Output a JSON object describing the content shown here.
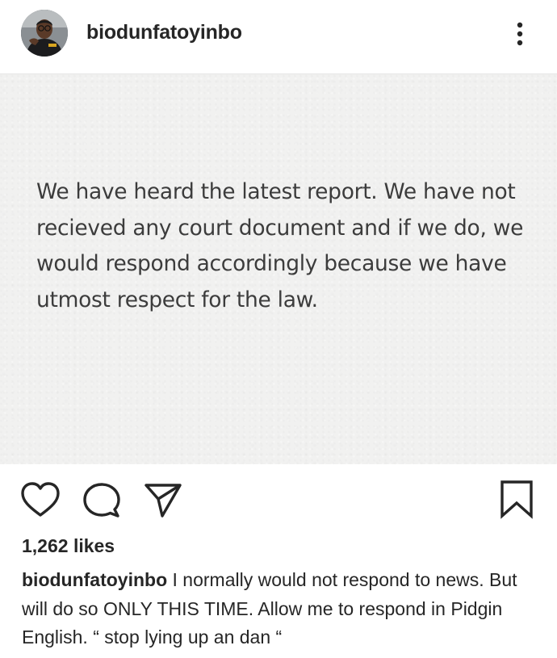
{
  "header": {
    "username": "biodunfatoyinbo",
    "avatar_icon": "profile-photo",
    "more_icon": "more-vertical-icon"
  },
  "post": {
    "text": "We have heard the latest report. We have not recieved any court document and if we do, we would respond accordingly because we have utmost respect for the law.",
    "background_color": "#f1f1f0",
    "text_color": "#3c3c3c"
  },
  "actions": {
    "like_icon": "heart-icon",
    "comment_icon": "comment-icon",
    "share_icon": "paper-plane-icon",
    "save_icon": "bookmark-icon"
  },
  "likes": "1,262 likes",
  "caption": {
    "username": "biodunfatoyinbo",
    "text": "I normally would not respond to news. But will do so ONLY THIS TIME. Allow me to respond in Pidgin English. “ stop lying up an dan “"
  }
}
